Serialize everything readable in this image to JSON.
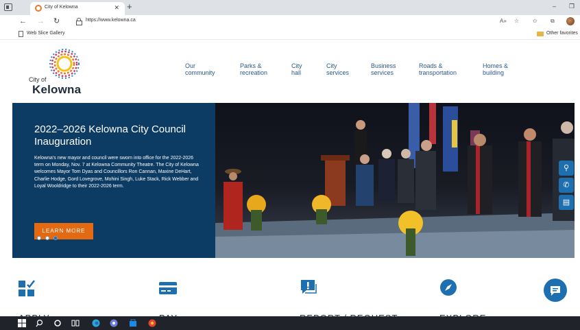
{
  "browser": {
    "tab_title": "City of Kelowna",
    "tab_close": "✕",
    "new_tab": "+",
    "window_minimize": "–",
    "window_restore": "❐",
    "url": "https://www.kelowna.ca",
    "favorites": {
      "item": "Web Slice Gallery",
      "other": "Other favorites"
    },
    "nav_icons": [
      "back-icon",
      "forward-icon",
      "refresh-icon",
      "read-aloud-icon",
      "favorites-add-icon",
      "favorites-icon",
      "collections-icon",
      "profile-icon"
    ]
  },
  "logo": {
    "city_of": "City of",
    "name": "Kelowna"
  },
  "main_nav": [
    {
      "label_1": "Our",
      "label_2": "community"
    },
    {
      "label_1": "Parks &",
      "label_2": "recreation"
    },
    {
      "label_1": "City",
      "label_2": "hall"
    },
    {
      "label_1": "City",
      "label_2": "services"
    },
    {
      "label_1": "Business",
      "label_2": "services"
    },
    {
      "label_1": "Roads &",
      "label_2": "transportation"
    },
    {
      "label_1": "Homes &",
      "label_2": "building"
    }
  ],
  "hero": {
    "title": "2022–2026 Kelowna City Council Inauguration",
    "body": "Kelowna’s new mayor and council were sworn into office for the 2022-2026 term on Monday, Nov. 7 at Kelowna Community Theatre. The City of Kelowna welcomes Mayor Tom Dyas and Councillors Ron Cannan, Maxine DeHart, Charlie Hodge, Gord Lovegrove, Mohini Singh, Luke Stack, Rick Webber and Loyal Wooldridge to their 2022-2026 term.",
    "cta": "LEARN MORE",
    "slide_count": 3,
    "active_slide": 2
  },
  "side_tools": [
    {
      "icon": "search-icon",
      "glyph": "⚲"
    },
    {
      "icon": "phone-icon",
      "glyph": "✆"
    },
    {
      "icon": "document-icon",
      "glyph": "▤"
    }
  ],
  "quick_links": [
    {
      "label": "APPLY",
      "icon": "checklist-icon"
    },
    {
      "label": "PAY",
      "icon": "credit-card-icon"
    },
    {
      "label": "REPORT / REQUEST",
      "icon": "report-icon"
    },
    {
      "label": "EXPLORE",
      "icon": "compass-icon"
    }
  ],
  "colors": {
    "hero_panel": "#0c3b64",
    "cta": "#e36a12",
    "nav_text": "#2a5a8a",
    "accent_blue": "#1d6fb0"
  }
}
